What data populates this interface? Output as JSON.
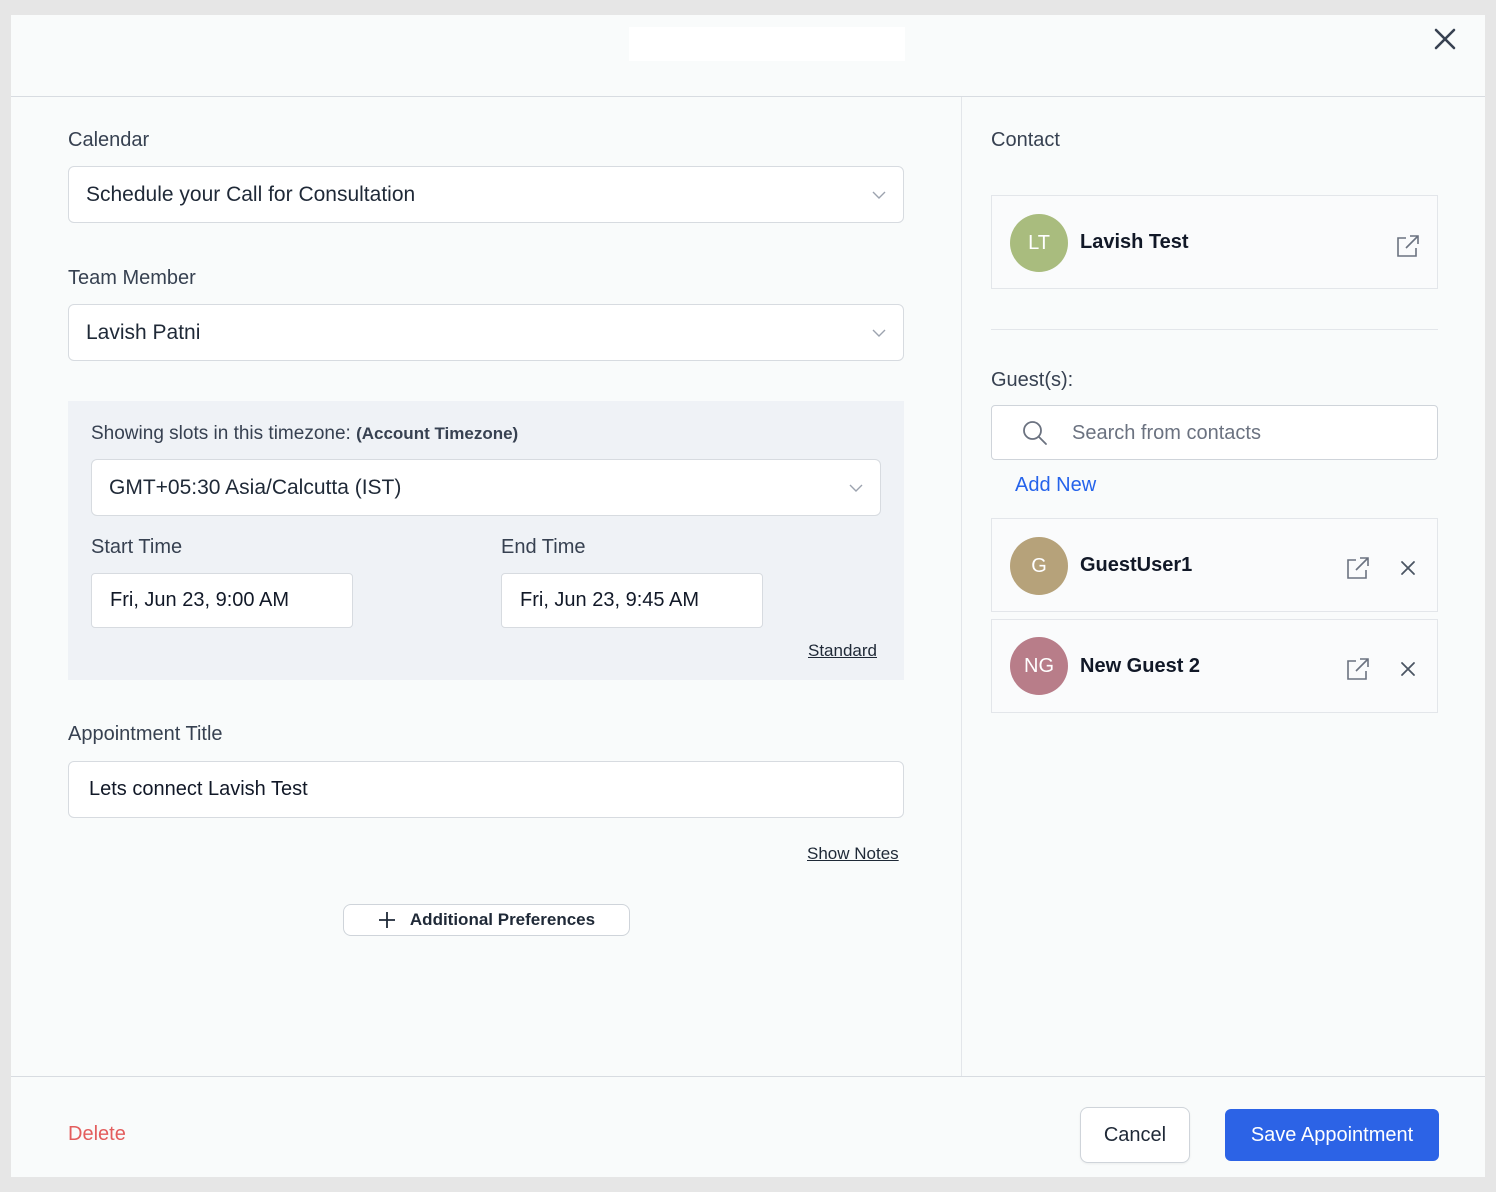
{
  "modal": {
    "close_icon": "close-icon"
  },
  "form": {
    "calendar": {
      "label": "Calendar",
      "value": "Schedule your Call for Consultation"
    },
    "team_member": {
      "label": "Team Member",
      "value": "Lavish Patni"
    },
    "timezone": {
      "label": "Showing slots in this timezone:",
      "label_bold": "(Account Timezone)",
      "value": "GMT+05:30 Asia/Calcutta (IST)"
    },
    "start_time": {
      "label": "Start Time",
      "value": "Fri, Jun 23, 9:00 AM"
    },
    "end_time": {
      "label": "End Time",
      "value": "Fri, Jun 23, 9:45 AM"
    },
    "standard_link": "Standard",
    "appointment_title": {
      "label": "Appointment Title",
      "value": "Lets connect Lavish Test"
    },
    "show_notes_link": "Show Notes",
    "additional_preferences": "Additional Preferences"
  },
  "contact": {
    "label": "Contact",
    "name": "Lavish Test",
    "initials": "LT",
    "avatar_color": "#a9bc7e"
  },
  "guests": {
    "label": "Guest(s):",
    "search_placeholder": "Search from contacts",
    "add_new": "Add New",
    "items": [
      {
        "name": "GuestUser1",
        "initials": "G",
        "avatar_color": "#b6a27a"
      },
      {
        "name": "New Guest 2",
        "initials": "NG",
        "avatar_color": "#b87d89"
      }
    ]
  },
  "footer": {
    "delete": "Delete",
    "cancel": "Cancel",
    "save": "Save Appointment"
  },
  "colors": {
    "primary": "#2c63e6",
    "danger": "#e35d5d",
    "link": "#2563eb"
  }
}
